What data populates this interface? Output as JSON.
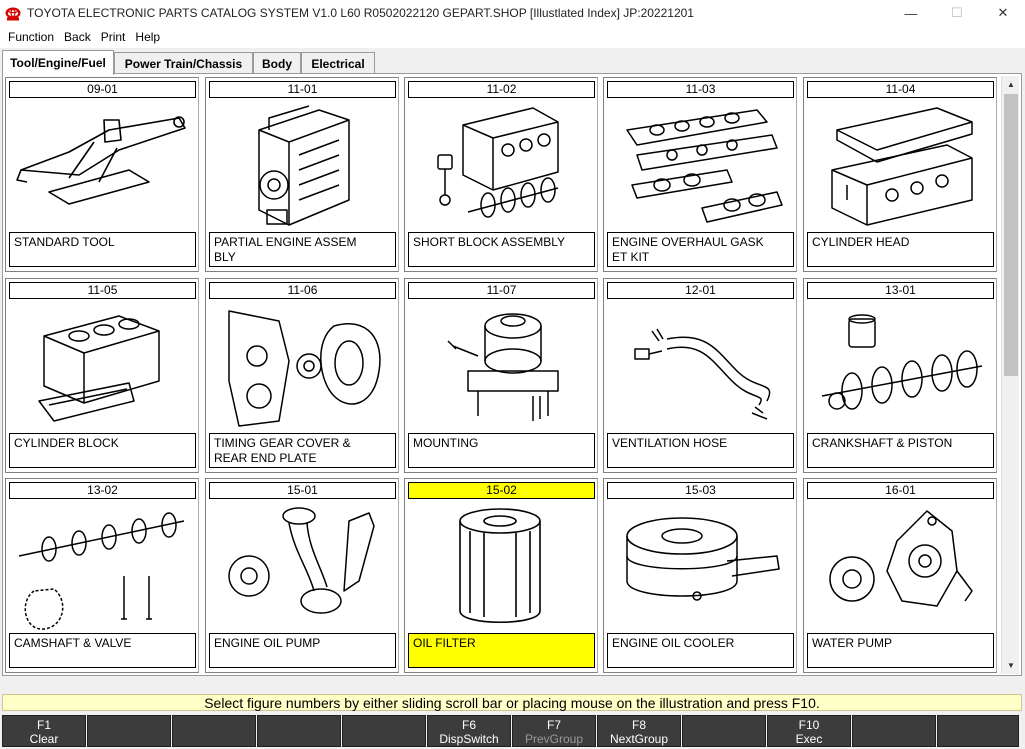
{
  "window": {
    "title": "TOYOTA ELECTRONIC PARTS CATALOG SYSTEM V1.0 L60 R0502022120 GEPART.SHOP [Illustlated Index] JP:20221201",
    "minimize": "—",
    "maximize": "☐",
    "close": "✕"
  },
  "menu": [
    "Function",
    "Back",
    "Print",
    "Help"
  ],
  "tabs": [
    {
      "label": "Tool/Engine/Fuel",
      "active": true
    },
    {
      "label": "Power Train/Chassis",
      "active": false
    },
    {
      "label": "Body",
      "active": false
    },
    {
      "label": "Electrical",
      "active": false
    }
  ],
  "figures": [
    {
      "code": "09-01",
      "name": "STANDARD TOOL",
      "icon": "jack-icon"
    },
    {
      "code": "11-01",
      "name": "PARTIAL ENGINE ASSEM\nBLY",
      "icon": "engine-assembly-icon"
    },
    {
      "code": "11-02",
      "name": "SHORT BLOCK ASSEMBLY",
      "icon": "short-block-icon"
    },
    {
      "code": "11-03",
      "name": "ENGINE OVERHAUL GASK\nET KIT",
      "icon": "gasket-kit-icon"
    },
    {
      "code": "11-04",
      "name": "CYLINDER HEAD",
      "icon": "cylinder-head-icon"
    },
    {
      "code": "11-05",
      "name": "CYLINDER BLOCK",
      "icon": "cylinder-block-icon"
    },
    {
      "code": "11-06",
      "name": "TIMING GEAR COVER &\nREAR END PLATE",
      "icon": "timing-cover-icon"
    },
    {
      "code": "11-07",
      "name": "MOUNTING",
      "icon": "mounting-icon"
    },
    {
      "code": "12-01",
      "name": "VENTILATION HOSE",
      "icon": "hose-icon"
    },
    {
      "code": "13-01",
      "name": "CRANKSHAFT & PISTON",
      "icon": "crankshaft-icon"
    },
    {
      "code": "13-02",
      "name": "CAMSHAFT & VALVE",
      "icon": "camshaft-icon"
    },
    {
      "code": "15-01",
      "name": "ENGINE OIL PUMP",
      "icon": "oil-pump-icon"
    },
    {
      "code": "15-02",
      "name": "OIL FILTER",
      "icon": "oil-filter-icon",
      "selected": true
    },
    {
      "code": "15-03",
      "name": "ENGINE OIL COOLER",
      "icon": "oil-cooler-icon"
    },
    {
      "code": "16-01",
      "name": "WATER PUMP",
      "icon": "water-pump-icon"
    }
  ],
  "status": "Select figure numbers by either sliding scroll bar or placing mouse on the illustration and press F10.",
  "fkeys": [
    {
      "key": "F1",
      "label": "Clear",
      "enabled": true
    },
    {
      "key": "",
      "label": "",
      "enabled": false
    },
    {
      "key": "",
      "label": "",
      "enabled": false
    },
    {
      "key": "",
      "label": "",
      "enabled": false
    },
    {
      "key": "",
      "label": "",
      "enabled": false
    },
    {
      "key": "F6",
      "label": "DispSwitch",
      "enabled": true
    },
    {
      "key": "F7",
      "label": "PrevGroup",
      "enabled": false
    },
    {
      "key": "F8",
      "label": "NextGroup",
      "enabled": true
    },
    {
      "key": "",
      "label": "",
      "enabled": false
    },
    {
      "key": "F10",
      "label": "Exec",
      "enabled": true
    },
    {
      "key": "",
      "label": "",
      "enabled": false
    },
    {
      "key": "",
      "label": "",
      "enabled": false
    }
  ],
  "colors": {
    "selected": "#ffff00",
    "status_bg": "#ffffc8",
    "fkey_bg": "#3c3c3c",
    "logo_red": "#d40000"
  }
}
